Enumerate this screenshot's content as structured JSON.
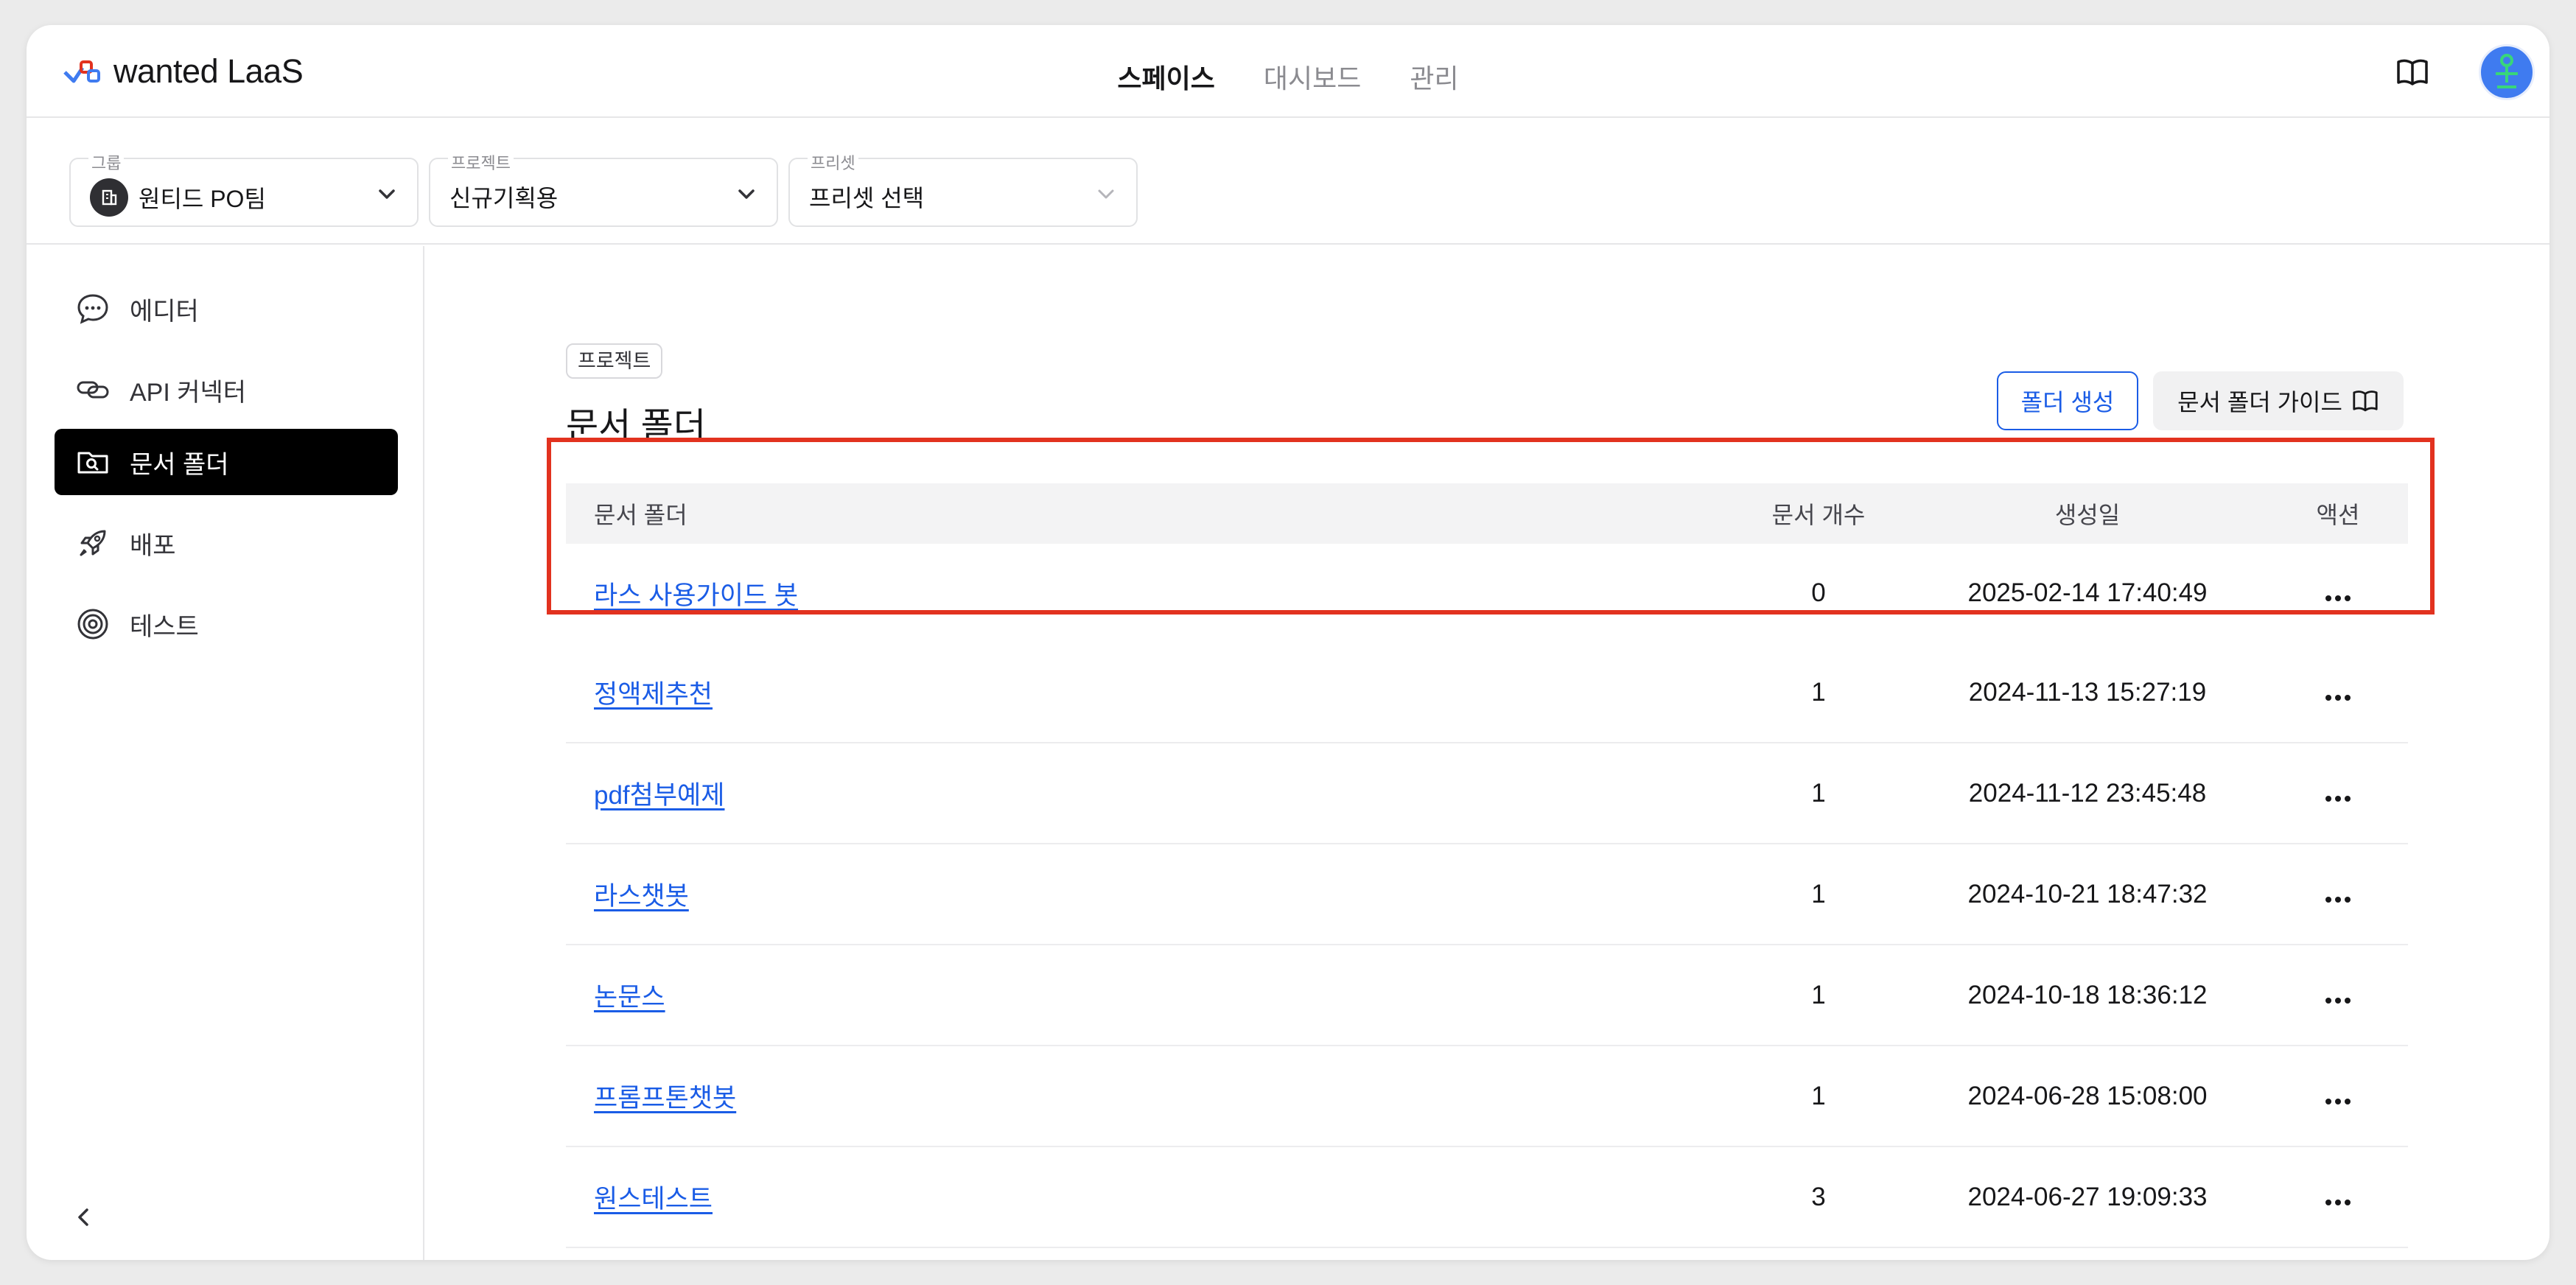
{
  "app": {
    "logo_text": "wanted LaaS"
  },
  "topnav": {
    "items": [
      "스페이스",
      "대시보드",
      "관리"
    ],
    "active": "스페이스"
  },
  "selectors": [
    {
      "label": "그룹",
      "value": "원티드 PO팀"
    },
    {
      "label": "프로젝트",
      "value": "신규기획용"
    },
    {
      "label": "프리셋",
      "value": "프리셋 선택"
    }
  ],
  "sidebar": {
    "items": [
      {
        "label": "에디터",
        "icon": "chat-bubble-icon"
      },
      {
        "label": "API 커넥터",
        "icon": "link-icon"
      },
      {
        "label": "문서 폴더",
        "icon": "folder-search-icon",
        "active": true
      },
      {
        "label": "배포",
        "icon": "rocket-icon"
      },
      {
        "label": "테스트",
        "icon": "target-icon"
      }
    ]
  },
  "main": {
    "chip": "프로젝트",
    "title": "문서 폴더",
    "create_button": "폴더 생성",
    "guide_button": "문서 폴더 가이드"
  },
  "table": {
    "headers": [
      "문서 폴더",
      "문서 개수",
      "생성일",
      "액션"
    ],
    "rows": [
      {
        "name": "라스 사용가이드 봇",
        "count": "0",
        "date": "2025-02-14 17:40:49"
      },
      {
        "name": "정액제추천",
        "count": "1",
        "date": "2024-11-13 15:27:19"
      },
      {
        "name": "pdf첨부예제",
        "count": "1",
        "date": "2024-11-12 23:45:48"
      },
      {
        "name": "라스챗봇",
        "count": "1",
        "date": "2024-10-21 18:47:32"
      },
      {
        "name": "논문스",
        "count": "1",
        "date": "2024-10-18 18:36:12"
      },
      {
        "name": "프롬프톤챗봇",
        "count": "1",
        "date": "2024-06-28 15:08:00"
      },
      {
        "name": "원스테스트",
        "count": "3",
        "date": "2024-06-27 19:09:33"
      }
    ]
  },
  "colors": {
    "accent": "#1a5ce6",
    "highlight": "#e2321f",
    "active_nav_bg": "#000000"
  }
}
